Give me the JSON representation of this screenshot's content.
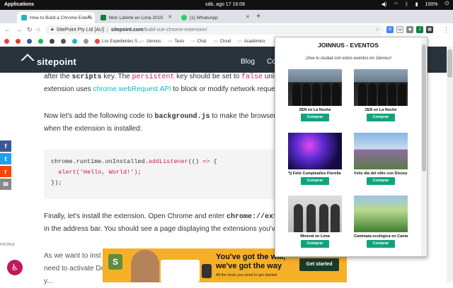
{
  "os": {
    "apps_label": "Applications",
    "clock": "sáb, ago 17  16:08",
    "battery": "100%"
  },
  "tabs": [
    {
      "label": "How to Build a Chrome Extens",
      "color": "#1fb5c8"
    },
    {
      "label": "Mon Laferte en Lima 2019",
      "color": "#0b8043"
    },
    {
      "label": "(1) WhatsApp",
      "color": "#25d366"
    }
  ],
  "newtab": "+",
  "address": {
    "site_name": "SitePoint Pty Ltd [AU]",
    "separator": "|",
    "domain": "sitepoint.com",
    "path": "/build-vue-chrome-extension/"
  },
  "bookmarks": [
    {
      "label": "",
      "color": "#d44"
    },
    {
      "label": "",
      "color": "#e33"
    },
    {
      "label": "",
      "color": "#3b5998"
    },
    {
      "label": "",
      "color": "#1db954"
    },
    {
      "label": "",
      "color": "#444"
    },
    {
      "label": "",
      "color": "#555"
    },
    {
      "label": "",
      "color": "#1fb5c8"
    },
    {
      "label": "",
      "color": "#999"
    },
    {
      "label": "Los Expedientes S...",
      "color": "#e44"
    },
    {
      "label": "Joinnus",
      "color": "#888"
    },
    {
      "label": "Tesis",
      "color": "#888"
    },
    {
      "label": "Chat",
      "color": "#888"
    },
    {
      "label": "Cloud",
      "color": "#888"
    },
    {
      "label": "Académico",
      "color": "#888"
    }
  ],
  "site": {
    "logo": "sitepoint",
    "nav_blog": "Blog",
    "nav_co": "Co"
  },
  "article": {
    "p1_a": "after the ",
    "p1_code1": "scripts",
    "p1_b": " key. The ",
    "p1_code2": "persistent",
    "p1_c": " key should be set to ",
    "p1_code3": "false",
    "p1_d": " unless",
    "p2_a": "extension uses ",
    "p2_link": "chrome.webRequest API",
    "p2_b": " to block or modify network requests.",
    "p3_a": "Now let's add the following code to ",
    "p3_code": "background.js",
    "p3_b": " to make the browser say",
    "p4": "when the extension is installed:",
    "code_line1_a": "chrome.runtime.onInstalled.",
    "code_line1_fn": "addListener",
    "code_line1_b": "(() ",
    "code_line1_arrow": "=>",
    "code_line1_c": " {",
    "code_line2_fn": "alert",
    "code_line2_str": "('Hello, World!')",
    "code_line2_end": ";",
    "code_line3": "});",
    "p5_a": "Finally, let's install the extension. Open Chrome and enter ",
    "p5_code": "chrome://extensi",
    "p6": "in the address bar. You should see a page displaying the extensions you've insta",
    "p7": "As we want to inst",
    "p8": "need to activate De",
    "p9": "y..."
  },
  "share": {
    "facebook": "f",
    "twitter": "t",
    "reddit": "r",
    "email": "✉"
  },
  "proper_label": "PROPER",
  "ad": {
    "shop_letter": "S",
    "head1": "You've got the will,",
    "head2": "we've got the way",
    "sub": "All the tools you need to get started",
    "cta": "Get started"
  },
  "popup": {
    "title": "JOINNUS - EVENTOS",
    "subtitle": "¡Vive tu ciudad con estos eventos en Joinnus!",
    "buy_label": "Comprar",
    "events": [
      {
        "name": "ZEN en La Noche"
      },
      {
        "name": "ZEN en La Noche"
      },
      {
        "name": "*|| Feliz Cumpleaños Fiorella ||*"
      },
      {
        "name": "Feliz día del niño con Disney"
      },
      {
        "name": "Mineral en Lima"
      },
      {
        "name": "Caminata ecológica en Canta"
      }
    ]
  }
}
